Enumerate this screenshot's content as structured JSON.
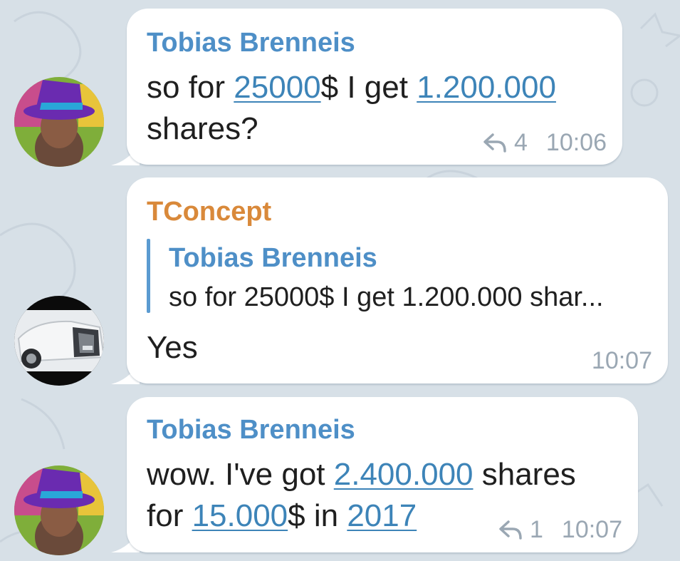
{
  "colors": {
    "background": "#d7e0e7",
    "bubble": "#ffffff",
    "sender_blue": "#4e8fc7",
    "sender_orange": "#d9893a",
    "link": "#3d84b8",
    "meta": "#9aa7b3",
    "quote_bar": "#5b9bd1"
  },
  "messages": [
    {
      "sender": "Tobias Brenneis",
      "line1_part1": "so for ",
      "line1_link1": "25000",
      "line1_part2": "$ I get ",
      "line1_link2": "1.200.000",
      "line2_part1": "shares?",
      "reply_icon": "reply-arrow-icon",
      "reply_count": "4",
      "time": "10:06"
    },
    {
      "sender": "TConcept",
      "quote_name": "Tobias Brenneis",
      "quote_text": "so for 25000$ I get 1.200.000 shar...",
      "text": "Yes",
      "time": "10:07"
    },
    {
      "sender": "Tobias Brenneis",
      "line1_part1": "wow. I've got ",
      "line1_link1": "2.400.000",
      "line1_part2": " shares",
      "line2_part1": "for ",
      "line2_link1": "15.000",
      "line2_part2": "$ in ",
      "line2_link2": "2017",
      "reply_icon": "reply-arrow-icon",
      "reply_count": "1",
      "time": "10:07"
    }
  ]
}
